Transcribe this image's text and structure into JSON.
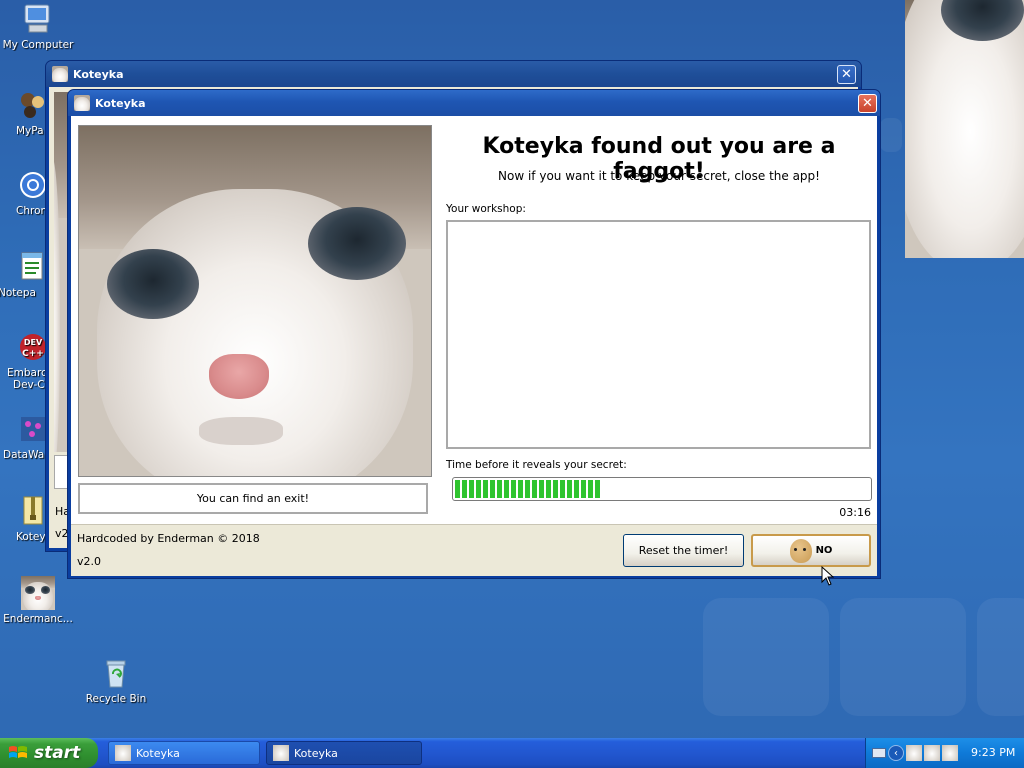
{
  "desktop": {
    "icons": [
      {
        "label": "My Computer"
      },
      {
        "label": "MyPa"
      },
      {
        "label": "Chrom"
      },
      {
        "label": "Notepa"
      },
      {
        "label": "Embarca"
      },
      {
        "label": "Dev-C"
      },
      {
        "label": "DataWa"
      },
      {
        "label": "Kotey"
      },
      {
        "label": "Endermanc..."
      },
      {
        "label": "Recycle Bin"
      }
    ]
  },
  "back_window": {
    "title": "Koteyka",
    "peek_labels": [
      "Ha",
      "v2"
    ]
  },
  "main_window": {
    "title": "Koteyka",
    "headline": "Koteyka found out you are a faggot!",
    "subline": "Now if you want it to keep your secret, close the app!",
    "workshop_label": "Your workshop:",
    "workshop_value": "",
    "exit_hint": "You can find an exit!",
    "timer_label": "Time before it reveals your secret:",
    "progress_fraction": 0.35,
    "timer_value": "03:16",
    "credit": "Hardcoded by Enderman © 2018",
    "version": "v2.0",
    "reset_button": "Reset the timer!",
    "no_button": "NO"
  },
  "taskbar": {
    "start_label": "start",
    "tasks": [
      {
        "label": "Koteyka"
      },
      {
        "label": "Koteyka"
      }
    ],
    "clock": "9:23 PM"
  },
  "colors": {
    "accent": "#2257d0",
    "progress_fill": "#2fc42f",
    "close_red": "#e0553c"
  }
}
